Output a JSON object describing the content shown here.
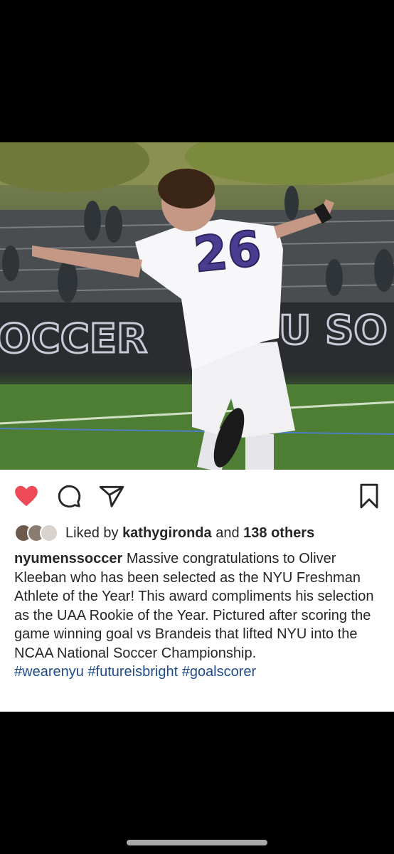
{
  "post": {
    "username": "nyumenssoccer",
    "photo": {
      "jersey_number": "26",
      "banner_left": "OCCER",
      "banner_right": "U SO"
    },
    "actions": {
      "like_icon": "heart-filled-icon",
      "comment_icon": "comment-icon",
      "share_icon": "paper-plane-icon",
      "save_icon": "bookmark-icon",
      "like_color": "#ed4956"
    },
    "likes": {
      "prefix": "Liked by ",
      "user": "kathygironda",
      "middle": " and ",
      "others": "138 others"
    },
    "caption": {
      "text": " Massive congratulations to Oliver Kleeban who has been selected as the NYU Freshman Athlete of the Year! This award compliments his selection as the UAA Rookie of the Year. Pictured after scoring the game winning goal vs Brandeis that lifted NYU into the NCAA National Soccer Championship.",
      "hashtags": "#wearenyu #futureisbright #goalscorer"
    }
  }
}
